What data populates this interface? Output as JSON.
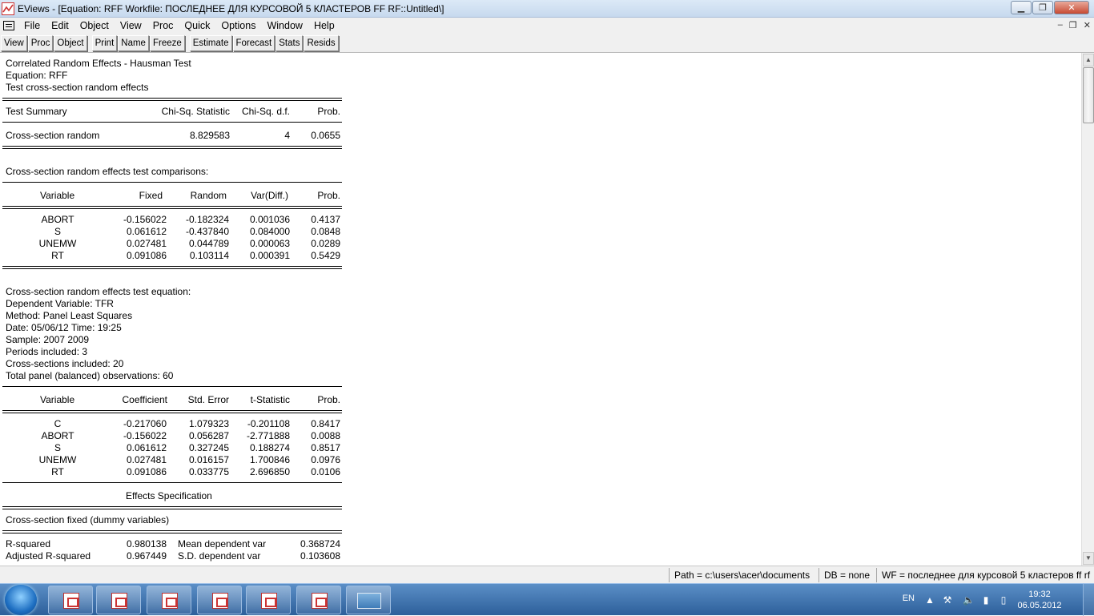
{
  "window": {
    "title": "EViews - [Equation: RFF    Workfile: ПОСЛЕДНЕЕ ДЛЯ КУРСОВОЙ 5 КЛАСТЕРОВ FF RF::Untitled\\]"
  },
  "menu": [
    "File",
    "Edit",
    "Object",
    "View",
    "Proc",
    "Quick",
    "Options",
    "Window",
    "Help"
  ],
  "toolbar": {
    "group1": [
      "View",
      "Proc",
      "Object"
    ],
    "group2": [
      "Print",
      "Name",
      "Freeze"
    ],
    "group3": [
      "Estimate",
      "Forecast",
      "Stats",
      "Resids"
    ]
  },
  "output": {
    "header": [
      "Correlated Random Effects - Hausman Test",
      "Equation: RFF",
      "Test cross-section random effects"
    ],
    "summary": {
      "cols": [
        "Test Summary",
        "Chi-Sq. Statistic",
        "Chi-Sq. d.f.",
        "Prob."
      ],
      "row": [
        "Cross-section random",
        "8.829583",
        "4",
        "0.0655"
      ]
    },
    "comparisons": {
      "title": "Cross-section random effects test comparisons:",
      "cols": [
        "Variable",
        "Fixed",
        "Random",
        "Var(Diff.)",
        "Prob."
      ],
      "rows": [
        [
          "ABORT",
          "-0.156022",
          "-0.182324",
          "0.001036",
          "0.4137"
        ],
        [
          "S",
          "0.061612",
          "-0.437840",
          "0.084000",
          "0.0848"
        ],
        [
          "UNEMW",
          "0.027481",
          "0.044789",
          "0.000063",
          "0.0289"
        ],
        [
          "RT",
          "0.091086",
          "0.103114",
          "0.000391",
          "0.5429"
        ]
      ]
    },
    "equation_info": [
      "Cross-section random effects test equation:",
      "Dependent Variable: TFR",
      "Method: Panel Least Squares",
      "Date: 05/06/12   Time: 19:25",
      "Sample: 2007 2009",
      "Periods included: 3",
      "Cross-sections included: 20",
      "Total panel (balanced) observations: 60"
    ],
    "coefficients": {
      "cols": [
        "Variable",
        "Coefficient",
        "Std. Error",
        "t-Statistic",
        "Prob."
      ],
      "rows": [
        [
          "C",
          "-0.217060",
          "1.079323",
          "-0.201108",
          "0.8417"
        ],
        [
          "ABORT",
          "-0.156022",
          "0.056287",
          "-2.771888",
          "0.0088"
        ],
        [
          "S",
          "0.061612",
          "0.327245",
          "0.188274",
          "0.8517"
        ],
        [
          "UNEMW",
          "0.027481",
          "0.016157",
          "1.700846",
          "0.0976"
        ],
        [
          "RT",
          "0.091086",
          "0.033775",
          "2.696850",
          "0.0106"
        ]
      ]
    },
    "effects_title": "Effects Specification",
    "effects_row": "Cross-section fixed (dummy variables)",
    "stats": [
      [
        "R-squared",
        "0.980138",
        "Mean dependent var",
        "0.368724"
      ],
      [
        "Adjusted R-squared",
        "0.967449",
        "S.D. dependent var",
        "0.103608"
      ]
    ]
  },
  "status": {
    "path": "Path = c:\\users\\acer\\documents",
    "db": "DB = none",
    "wf": "WF = последнее для курсовой 5 кластеров ff rf"
  },
  "taskbar": {
    "lang": "EN",
    "time": "19:32",
    "date": "06.05.2012"
  }
}
